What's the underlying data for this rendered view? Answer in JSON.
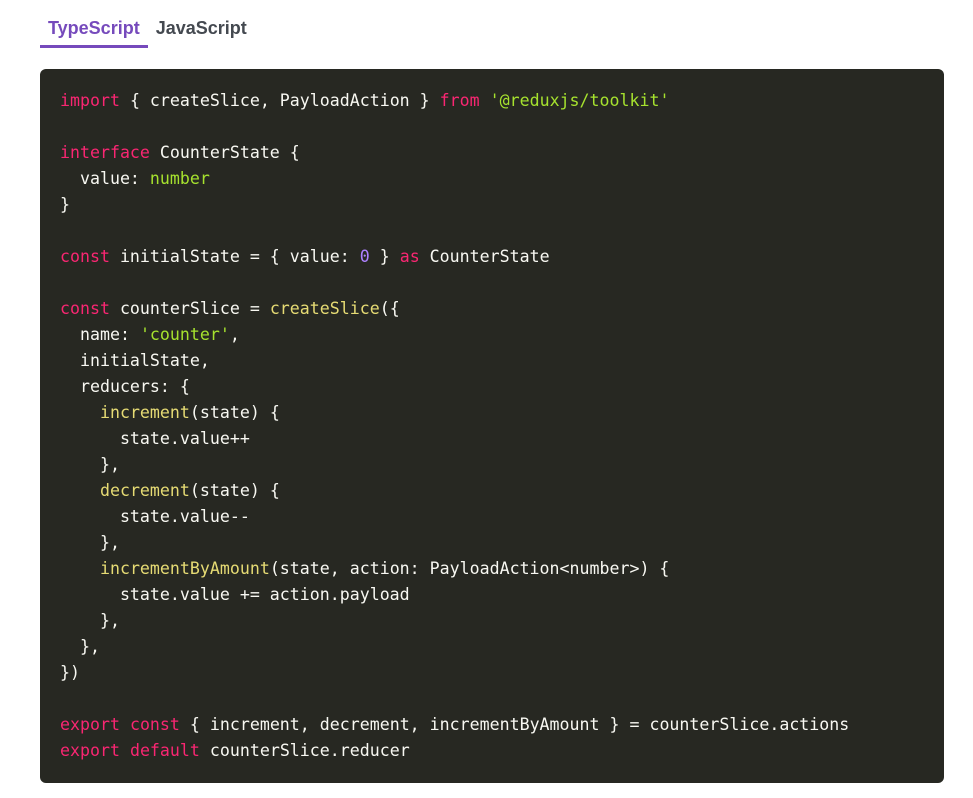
{
  "tabs": [
    {
      "label": "TypeScript",
      "active": true
    },
    {
      "label": "JavaScript",
      "active": false
    }
  ],
  "code": {
    "language": "typescript",
    "lines": [
      [
        {
          "t": "import",
          "c": "kw"
        },
        {
          "t": " { createSlice, PayloadAction } ",
          "c": ""
        },
        {
          "t": "from",
          "c": "kw"
        },
        {
          "t": " ",
          "c": ""
        },
        {
          "t": "'@reduxjs/toolkit'",
          "c": "str"
        }
      ],
      [],
      [
        {
          "t": "interface",
          "c": "kw"
        },
        {
          "t": " CounterState {",
          "c": ""
        }
      ],
      [
        {
          "t": "  value: ",
          "c": ""
        },
        {
          "t": "number",
          "c": "type"
        }
      ],
      [
        {
          "t": "}",
          "c": ""
        }
      ],
      [],
      [
        {
          "t": "const",
          "c": "kw"
        },
        {
          "t": " initialState = { value: ",
          "c": ""
        },
        {
          "t": "0",
          "c": "num"
        },
        {
          "t": " } ",
          "c": ""
        },
        {
          "t": "as",
          "c": "kw"
        },
        {
          "t": " CounterState",
          "c": ""
        }
      ],
      [],
      [
        {
          "t": "const",
          "c": "kw"
        },
        {
          "t": " counterSlice = ",
          "c": ""
        },
        {
          "t": "createSlice",
          "c": "fn"
        },
        {
          "t": "({",
          "c": ""
        }
      ],
      [
        {
          "t": "  name: ",
          "c": ""
        },
        {
          "t": "'counter'",
          "c": "str"
        },
        {
          "t": ",",
          "c": ""
        }
      ],
      [
        {
          "t": "  initialState,",
          "c": ""
        }
      ],
      [
        {
          "t": "  reducers: {",
          "c": ""
        }
      ],
      [
        {
          "t": "    ",
          "c": ""
        },
        {
          "t": "increment",
          "c": "fn"
        },
        {
          "t": "(state) {",
          "c": ""
        }
      ],
      [
        {
          "t": "      state.value++",
          "c": ""
        }
      ],
      [
        {
          "t": "    },",
          "c": ""
        }
      ],
      [
        {
          "t": "    ",
          "c": ""
        },
        {
          "t": "decrement",
          "c": "fn"
        },
        {
          "t": "(state) {",
          "c": ""
        }
      ],
      [
        {
          "t": "      state.value--",
          "c": ""
        }
      ],
      [
        {
          "t": "    },",
          "c": ""
        }
      ],
      [
        {
          "t": "    ",
          "c": ""
        },
        {
          "t": "incrementByAmount",
          "c": "fn"
        },
        {
          "t": "(state, action: PayloadAction<number>) {",
          "c": ""
        }
      ],
      [
        {
          "t": "      state.value += action.payload",
          "c": ""
        }
      ],
      [
        {
          "t": "    },",
          "c": ""
        }
      ],
      [
        {
          "t": "  },",
          "c": ""
        }
      ],
      [
        {
          "t": "})",
          "c": ""
        }
      ],
      [],
      [
        {
          "t": "export",
          "c": "kw"
        },
        {
          "t": " ",
          "c": ""
        },
        {
          "t": "const",
          "c": "kw"
        },
        {
          "t": " { increment, decrement, incrementByAmount } = counterSlice.actions",
          "c": ""
        }
      ],
      [
        {
          "t": "export",
          "c": "kw"
        },
        {
          "t": " ",
          "c": ""
        },
        {
          "t": "default",
          "c": "kw"
        },
        {
          "t": " counterSlice.reducer",
          "c": ""
        }
      ]
    ]
  },
  "colors": {
    "accent": "#764abc",
    "code_background": "#272822",
    "keyword": "#f92672",
    "string": "#a6e22e",
    "function": "#e6db74",
    "number": "#ae81ff",
    "text": "#f8f8f2"
  }
}
